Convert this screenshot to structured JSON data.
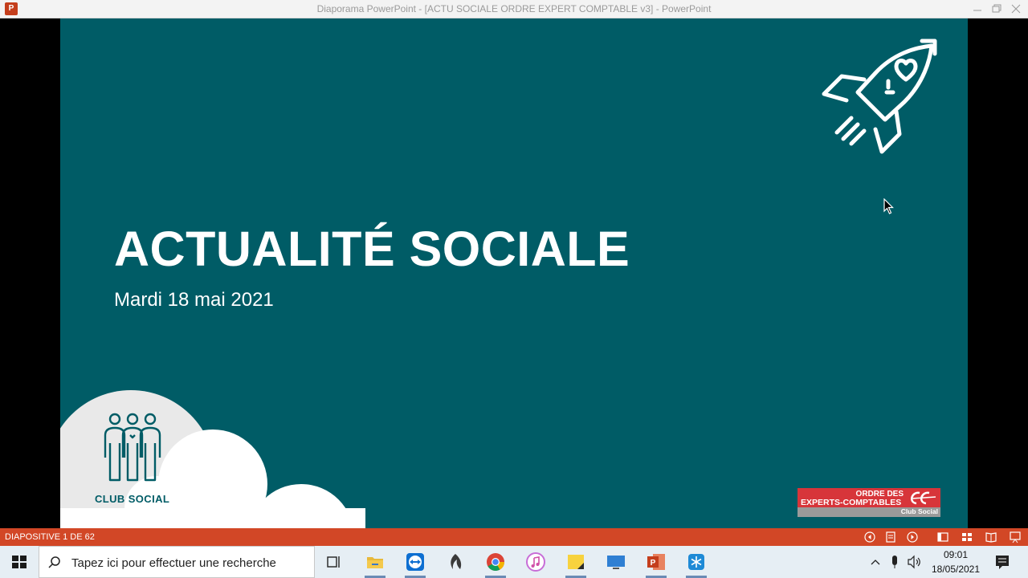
{
  "window": {
    "title": "Diaporama PowerPoint - [ACTU SOCIALE ORDRE EXPERT COMPTABLE v3] - PowerPoint",
    "app_icon_letter": "P",
    "controls": [
      "minimize-icon",
      "restore-icon",
      "close-icon"
    ]
  },
  "slide": {
    "title": "ACTUALITÉ SOCIALE",
    "subtitle": "Mardi 18 mai 2021",
    "background": "#005c66",
    "club_label": "CLUB SOCIAL",
    "logo": {
      "line1": "ORDRE DES",
      "line2": "EXPERTS-COMPTABLES",
      "band_label": "Club Social",
      "color": "#d7353a"
    }
  },
  "statusbar": {
    "slide_counter": "DIAPOSITIVE 1 DE 62",
    "color": "#d24726",
    "buttons": [
      "previous-icon",
      "slide-notes-icon",
      "next-icon",
      "normal-view-icon",
      "slide-sorter-icon",
      "reading-view-icon",
      "slideshow-icon"
    ]
  },
  "taskbar": {
    "search_placeholder": "Tapez ici pour effectuer une recherche",
    "apps": [
      "task-view-icon",
      "file-explorer-icon",
      "teamviewer-icon",
      "dragon-icon",
      "chrome-icon",
      "itunes-icon",
      "sticky-notes-icon",
      "remote-desktop-icon",
      "powerpoint-icon",
      "snowflake-app-icon"
    ],
    "tray": [
      "show-hidden-icons-icon",
      "microphone-icon",
      "volume-icon",
      "notifications-icon"
    ],
    "time": "09:01",
    "date": "18/05/2021"
  }
}
